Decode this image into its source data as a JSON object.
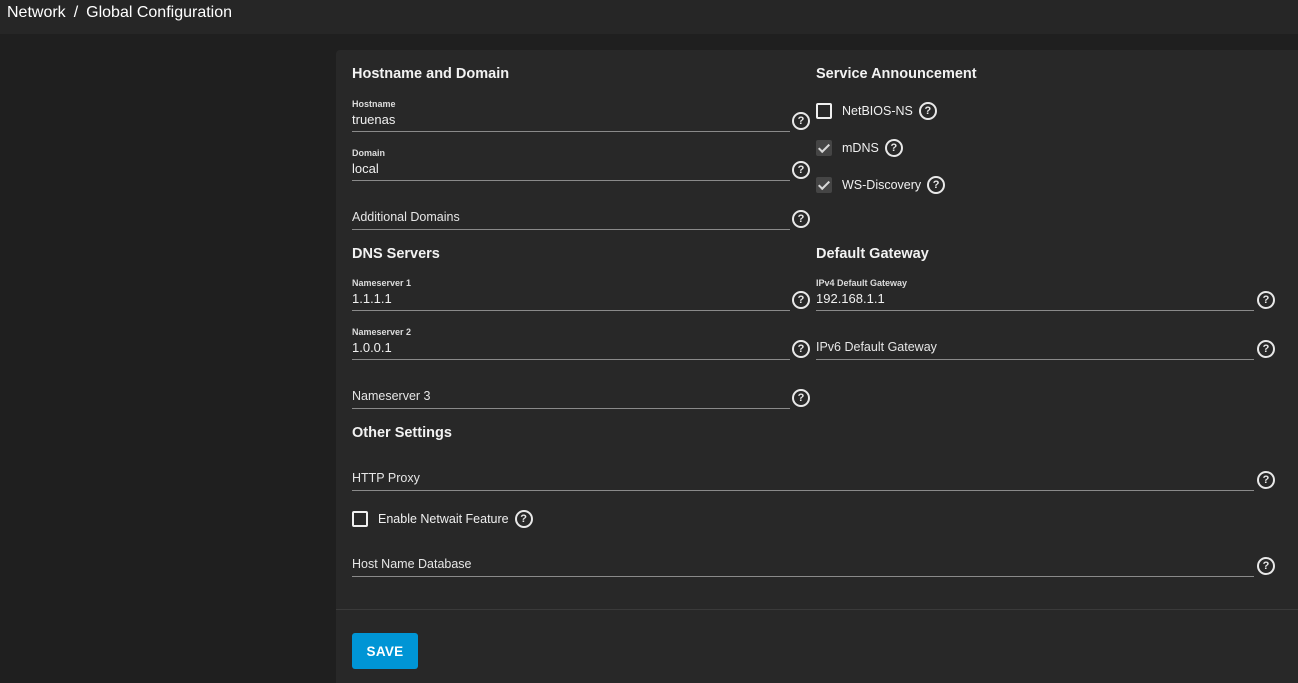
{
  "breadcrumb": {
    "parent": "Network",
    "separator": "/",
    "current": "Global Configuration"
  },
  "sections": {
    "hostname_domain": "Hostname and Domain",
    "service_announcement": "Service Announcement",
    "dns_servers": "DNS Servers",
    "default_gateway": "Default Gateway",
    "other_settings": "Other Settings"
  },
  "fields": {
    "hostname": {
      "label": "Hostname",
      "value": "truenas"
    },
    "domain": {
      "label": "Domain",
      "value": "local"
    },
    "additional_domains": {
      "placeholder": "Additional Domains"
    },
    "nameserver1": {
      "label": "Nameserver 1",
      "value": "1.1.1.1"
    },
    "nameserver2": {
      "label": "Nameserver 2",
      "value": "1.0.0.1"
    },
    "nameserver3": {
      "placeholder": "Nameserver 3"
    },
    "ipv4_gateway": {
      "label": "IPv4 Default Gateway",
      "value": "192.168.1.1"
    },
    "ipv6_gateway": {
      "placeholder": "IPv6 Default Gateway"
    },
    "http_proxy": {
      "placeholder": "HTTP Proxy"
    },
    "host_name_database": {
      "placeholder": "Host Name Database"
    }
  },
  "checkboxes": {
    "netbios_ns": {
      "label": "NetBIOS-NS",
      "checked": false
    },
    "mdns": {
      "label": "mDNS",
      "checked": true
    },
    "ws_discovery": {
      "label": "WS-Discovery",
      "checked": true
    },
    "netwait": {
      "label": "Enable Netwait Feature",
      "checked": false
    }
  },
  "help_glyph": "?",
  "icons": {
    "help": "help-circle-icon",
    "check": "check-icon"
  },
  "actions": {
    "save_label": "SAVE"
  },
  "colors": {
    "accent": "#0095d5",
    "background": "#1f1f1f",
    "card": "#282828"
  }
}
